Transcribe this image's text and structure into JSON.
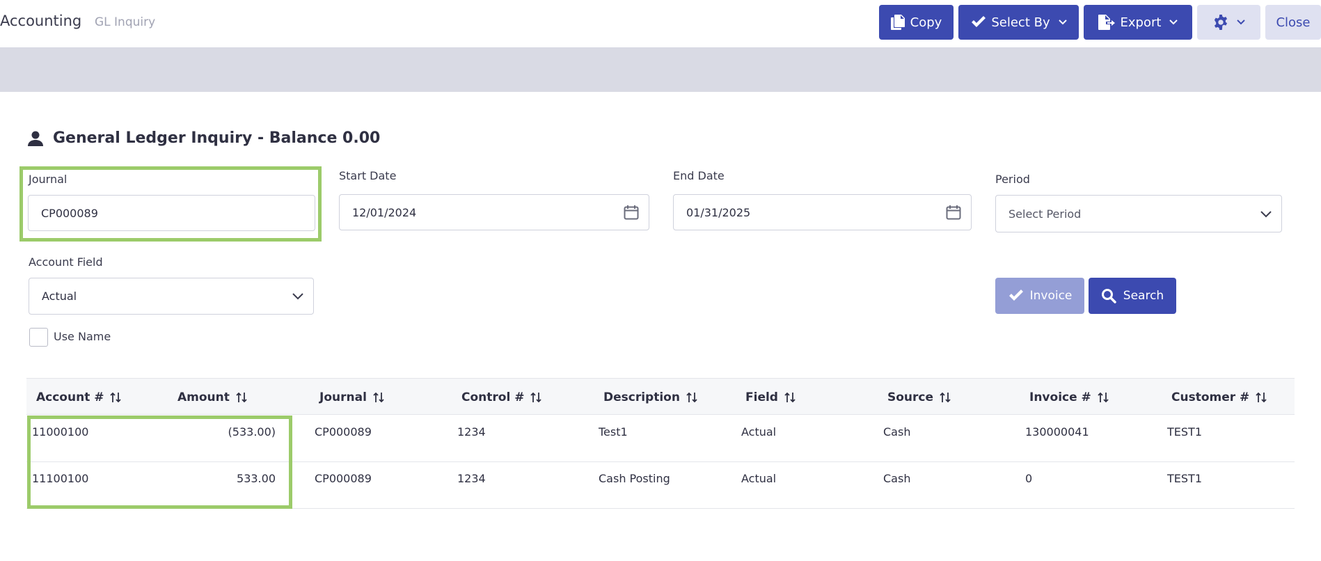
{
  "header": {
    "app_title": "Accounting",
    "breadcrumb": "GL Inquiry",
    "copy_label": "Copy",
    "select_by_label": "Select By",
    "export_label": "Export",
    "close_label": "Close"
  },
  "card": {
    "title": "General Ledger Inquiry - Balance 0.00"
  },
  "form": {
    "journal_label": "Journal",
    "journal_value": "CP000089",
    "start_date_label": "Start Date",
    "start_date_value": "12/01/2024",
    "end_date_label": "End Date",
    "end_date_value": "01/31/2025",
    "period_label": "Period",
    "period_placeholder": "Select Period",
    "account_field_label": "Account Field",
    "account_field_value": "Actual",
    "use_name_label": "Use Name",
    "invoice_label": "Invoice",
    "search_label": "Search"
  },
  "table": {
    "columns": [
      "Account #",
      "Amount",
      "Journal",
      "Control #",
      "Description",
      "Field",
      "Source",
      "Invoice #",
      "Customer #"
    ],
    "rows": [
      [
        "11000100",
        "(533.00)",
        "CP000089",
        "1234",
        "Test1",
        "Actual",
        "Cash",
        "130000041",
        "TEST1"
      ],
      [
        "11100100",
        "533.00",
        "CP000089",
        "1234",
        "Cash Posting",
        "Actual",
        "Cash",
        "0",
        "TEST1"
      ]
    ]
  },
  "colors": {
    "primary": "#3c4ab0",
    "primary_disabled": "#949ed6",
    "highlight": "#9ccb6a",
    "band": "#d9dae4"
  },
  "icons": {
    "copy": "copy-icon",
    "select_by": "check-icon",
    "export": "export-icon",
    "settings": "gear-icon",
    "title": "user-icon",
    "calendar": "calendar-icon",
    "dropdown": "chevron-down-icon",
    "search": "search-icon",
    "sort": "sort-icon"
  }
}
